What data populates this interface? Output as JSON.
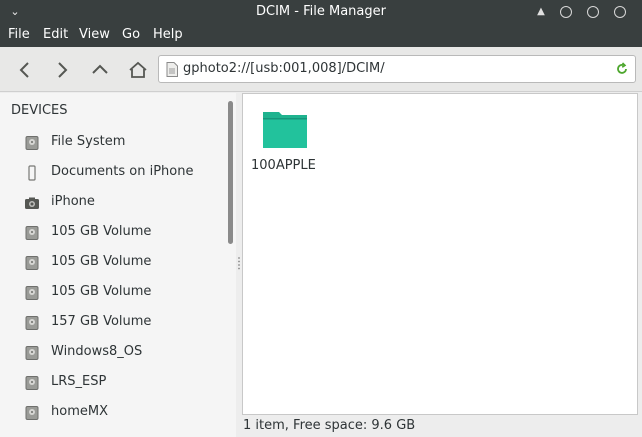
{
  "window": {
    "title": "DCIM - File Manager",
    "menu_glyph": "⌄"
  },
  "menubar": {
    "items": [
      "File",
      "Edit",
      "View",
      "Go",
      "Help"
    ]
  },
  "toolbar": {
    "back": "chevron-left-icon",
    "forward": "chevron-right-icon",
    "up": "chevron-up-icon",
    "home": "home-icon",
    "location": "gphoto2://[usb:001,008]/DCIM/",
    "reload_color": "#4ea72e"
  },
  "sidebar": {
    "heading": "DEVICES",
    "items": [
      {
        "label": "File System",
        "icon": "drive-icon"
      },
      {
        "label": "Documents on iPhone",
        "icon": "phone-icon"
      },
      {
        "label": "iPhone",
        "icon": "camera-icon"
      },
      {
        "label": "105 GB Volume",
        "icon": "drive-icon"
      },
      {
        "label": "105 GB Volume",
        "icon": "drive-icon"
      },
      {
        "label": "105 GB Volume",
        "icon": "drive-icon"
      },
      {
        "label": "157 GB Volume",
        "icon": "drive-icon"
      },
      {
        "label": "Windows8_OS",
        "icon": "drive-icon"
      },
      {
        "label": "LRS_ESP",
        "icon": "drive-icon"
      },
      {
        "label": "homeMX",
        "icon": "drive-icon"
      }
    ]
  },
  "content": {
    "items": [
      {
        "name": "100APPLE",
        "type": "folder",
        "color": "#1fb38f"
      }
    ]
  },
  "status": {
    "text": "1 item, Free space: 9.6 GB"
  }
}
